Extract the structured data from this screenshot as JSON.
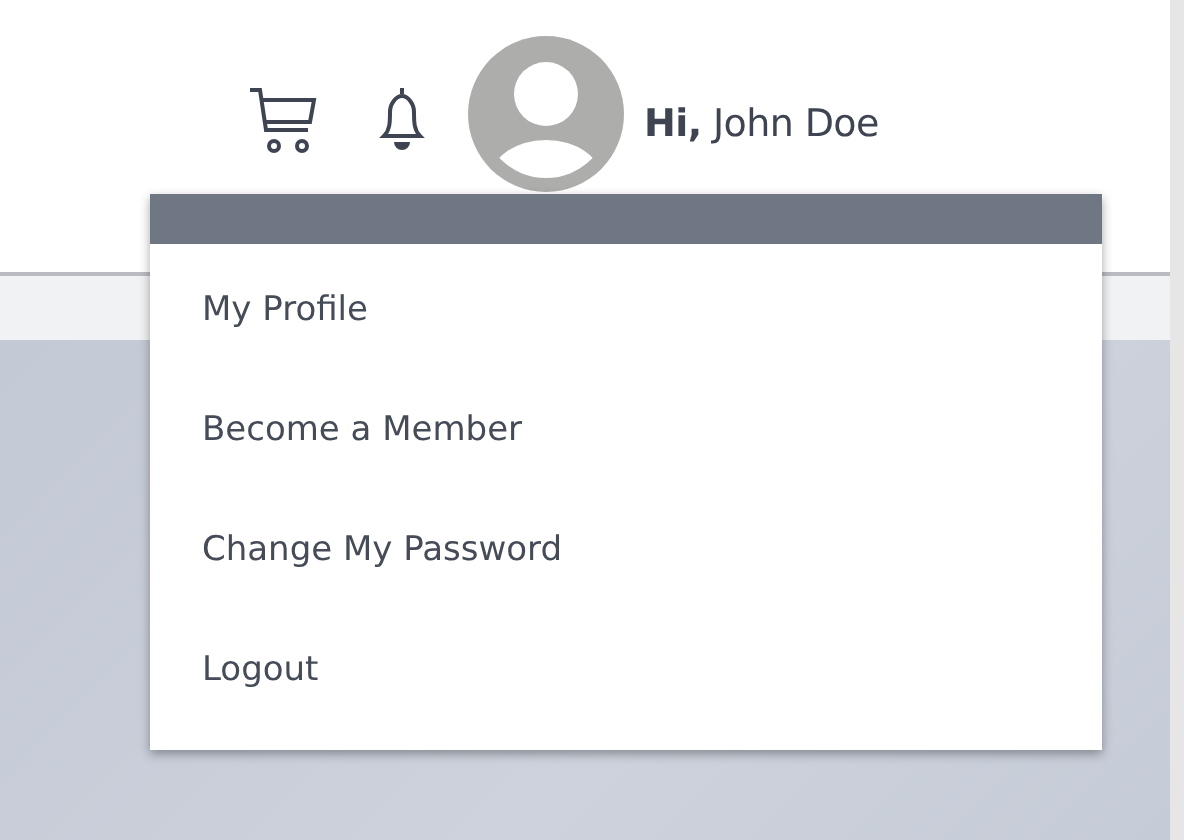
{
  "header": {
    "greeting": "**Hi,** John Doe"
  },
  "user_menu": {
    "items": [
      {
        "label": "My Profile"
      },
      {
        "label": "Become a Member"
      },
      {
        "label": "Change My Password"
      },
      {
        "label": "Logout"
      }
    ]
  }
}
